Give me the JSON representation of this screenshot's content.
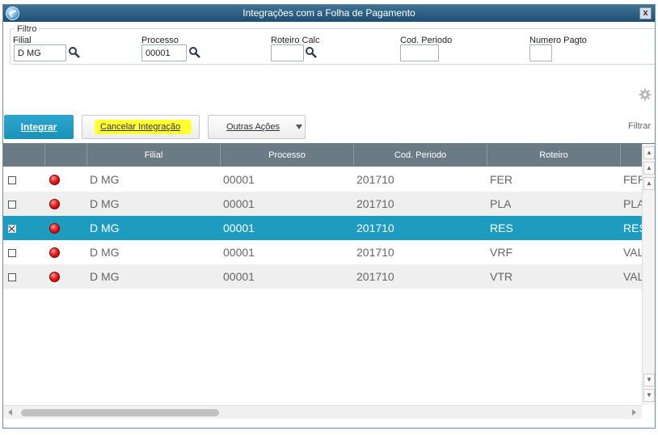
{
  "window": {
    "title": "Integrações com a Folha de Pagamento",
    "close_label": "x"
  },
  "filter": {
    "legend": "Filtro",
    "filial": {
      "label": "Filial",
      "value": "D MG"
    },
    "processo": {
      "label": "Processo",
      "value": "00001"
    },
    "roteiro": {
      "label": "Roteiro Calc",
      "value": ""
    },
    "periodo": {
      "label": "Cod. Periodo",
      "value": ""
    },
    "pagto": {
      "label": "Numero Pagto",
      "value": ""
    }
  },
  "actions": {
    "integrar": "Integrar",
    "cancelar": "Cancelar Integração",
    "outras": "Outras Ações",
    "filtrar": "Filtrar"
  },
  "grid": {
    "columns": [
      "",
      "",
      "Filial",
      "Processo",
      "Cod. Periodo",
      "Roteiro",
      ""
    ],
    "rows": [
      {
        "checked": false,
        "status": "red",
        "filial": "D MG",
        "processo": "00001",
        "periodo": "201710",
        "roteiro": "FER",
        "extra": "FER"
      },
      {
        "checked": false,
        "status": "red",
        "filial": "D MG",
        "processo": "00001",
        "periodo": "201710",
        "roteiro": "PLA",
        "extra": "PLA"
      },
      {
        "checked": true,
        "status": "red",
        "filial": "D MG",
        "processo": "00001",
        "periodo": "201710",
        "roteiro": "RES",
        "extra": "RES"
      },
      {
        "checked": false,
        "status": "red",
        "filial": "D MG",
        "processo": "00001",
        "periodo": "201710",
        "roteiro": "VRF",
        "extra": "VAL"
      },
      {
        "checked": false,
        "status": "red",
        "filial": "D MG",
        "processo": "00001",
        "periodo": "201710",
        "roteiro": "VTR",
        "extra": "VAL"
      }
    ],
    "selected_row": 2
  },
  "colors": {
    "accent": "#1e9cc0",
    "header": "#6a7b86",
    "highlight": "#ffff32",
    "status_red": "#e52020"
  }
}
